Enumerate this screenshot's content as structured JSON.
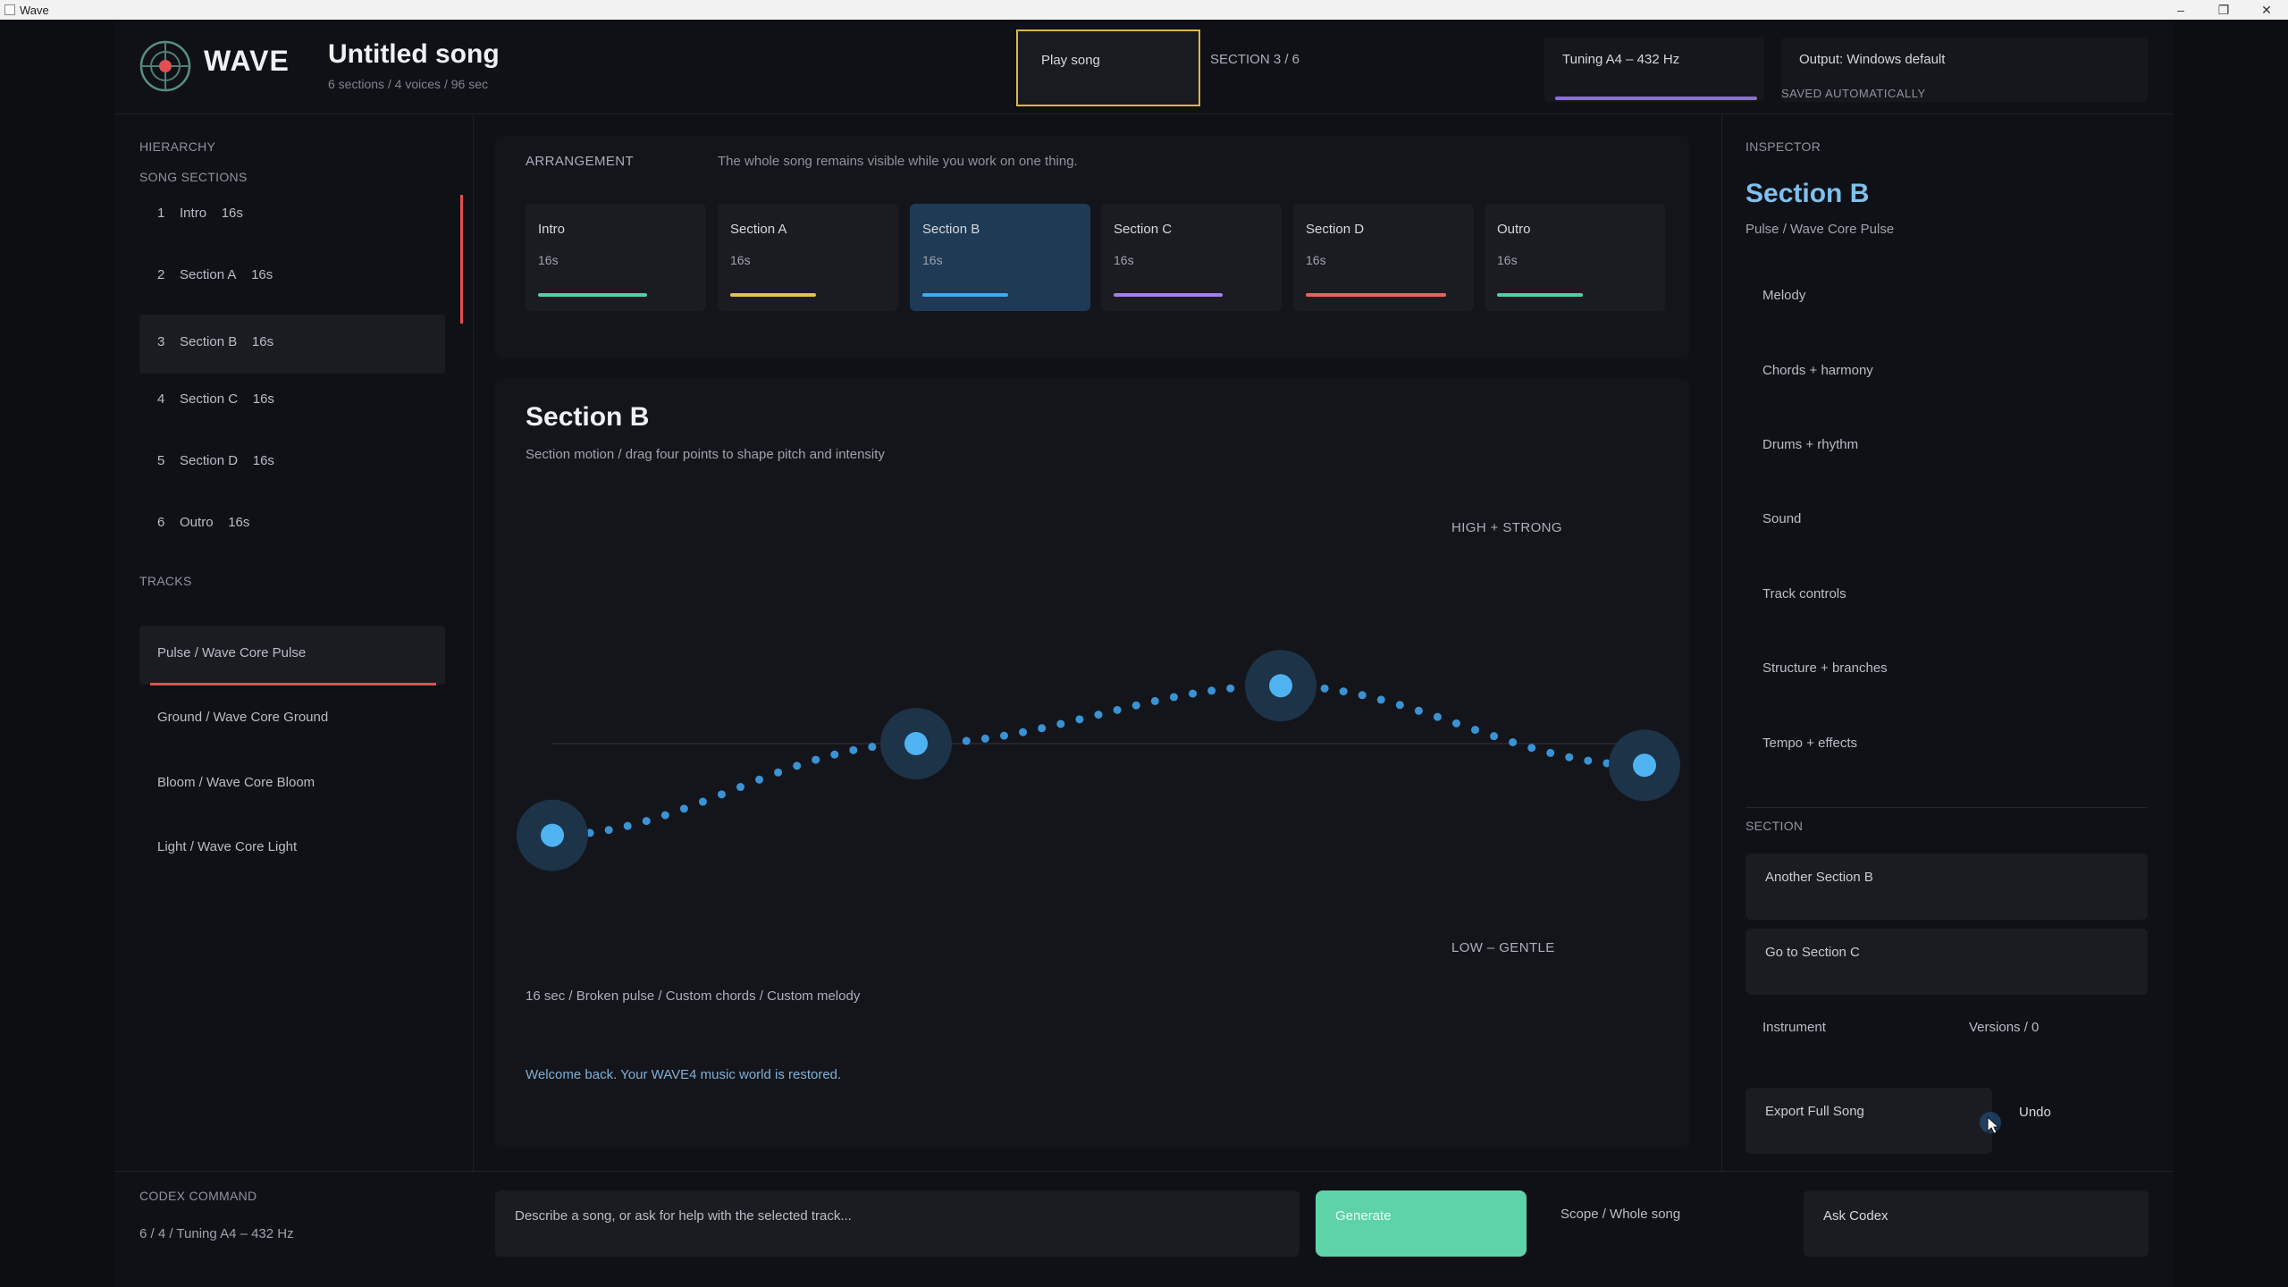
{
  "window": {
    "title": "Wave"
  },
  "header": {
    "brand": "WAVE",
    "song_title": "Untitled song",
    "song_meta": "6 sections / 4 voices / 96 sec",
    "play_label": "Play song",
    "section_counter": "SECTION 3 / 6",
    "tuning": "Tuning  A4 – 432 Hz",
    "output": "Output: Windows default",
    "saved": "SAVED AUTOMATICALLY"
  },
  "sidebar": {
    "hierarchy_label": "HIERARCHY",
    "sections_label": "SONG SECTIONS",
    "sections": [
      {
        "num": "1",
        "name": "Intro",
        "dur": "16s"
      },
      {
        "num": "2",
        "name": "Section A",
        "dur": "16s"
      },
      {
        "num": "3",
        "name": "Section B",
        "dur": "16s"
      },
      {
        "num": "4",
        "name": "Section C",
        "dur": "16s"
      },
      {
        "num": "5",
        "name": "Section D",
        "dur": "16s"
      },
      {
        "num": "6",
        "name": "Outro",
        "dur": "16s"
      }
    ],
    "tracks_label": "TRACKS",
    "tracks": [
      {
        "label": "Pulse   /   Wave Core Pulse"
      },
      {
        "label": "Ground   /   Wave Core Ground"
      },
      {
        "label": "Bloom   /   Wave Core Bloom"
      },
      {
        "label": "Light   /   Wave Core Light"
      }
    ]
  },
  "arrangement": {
    "label": "ARRANGEMENT",
    "subtitle": "The whole song remains visible while you work on one thing.",
    "cards": [
      {
        "name": "Intro",
        "dur": "16s",
        "color": "#4fd1a5",
        "bar_fraction": 0.7
      },
      {
        "name": "Section A",
        "dur": "16s",
        "color": "#e6c14f",
        "bar_fraction": 0.55
      },
      {
        "name": "Section B",
        "dur": "16s",
        "color": "#3fa9f5",
        "bar_fraction": 0.55
      },
      {
        "name": "Section C",
        "dur": "16s",
        "color": "#a67cf0",
        "bar_fraction": 0.7
      },
      {
        "name": "Section D",
        "dur": "16s",
        "color": "#f0605a",
        "bar_fraction": 0.9
      },
      {
        "name": "Outro",
        "dur": "16s",
        "color": "#4fd1a5",
        "bar_fraction": 0.55
      }
    ]
  },
  "editor": {
    "title": "Section B",
    "subtitle": "Section motion / drag four points to shape pitch and intensity",
    "high_label": "HIGH + STRONG",
    "low_label": "LOW – GENTLE",
    "summary": "16 sec / Broken pulse / Custom chords / Custom melody",
    "welcome": "Welcome back. Your WAVE4 music world is restored.",
    "curve_levels": [
      -0.38,
      0.0,
      0.24,
      -0.09
    ]
  },
  "inspector": {
    "label": "INSPECTOR",
    "title": "Section B",
    "subtitle": "Pulse / Wave Core Pulse",
    "items": [
      "Melody",
      "Chords + harmony",
      "Drums + rhythm",
      "Sound",
      "Track controls",
      "Structure + branches",
      "Tempo + effects"
    ],
    "section_label": "SECTION",
    "another_section": "Another Section B",
    "go_to": "Go to Section C",
    "instrument": "Instrument",
    "versions": "Versions / 0",
    "export": "Export Full Song",
    "undo": "Undo"
  },
  "bottom": {
    "codex_label": "CODEX COMMAND",
    "codex_meta": "6 / 4 / Tuning  A4 – 432 Hz",
    "prompt_placeholder": "Describe a song, or ask for help with the selected track...",
    "generate": "Generate",
    "scope": "Scope / Whole song",
    "ask": "Ask Codex"
  },
  "colors": {
    "accent": "#3fa9f5",
    "play_border": "#d9b64c",
    "generate": "#5fd3a8",
    "selected_track_line": "#e0504e"
  }
}
